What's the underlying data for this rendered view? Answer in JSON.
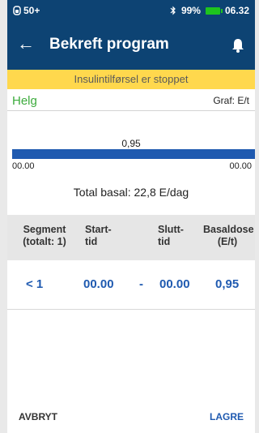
{
  "status_bar": {
    "pod_level": "50+",
    "battery_percent": "99%",
    "time": "06.32",
    "battery_color": "#1ec41e"
  },
  "header": {
    "title": "Bekreft program",
    "back_icon": "back-arrow-icon",
    "bell_icon": "bell-icon",
    "background_color": "#0d4373"
  },
  "banner": {
    "text": "Insulintilførsel er stoppet",
    "color": "#ffd84d"
  },
  "program": {
    "name": "Helg",
    "graph_unit": "Graf: E/t"
  },
  "graph": {
    "bar_label": "0,95",
    "start_tick": "00.00",
    "end_tick": "00.00",
    "bar_color": "#1f5ab0"
  },
  "total_basal": "Total basal: 22,8 E/dag",
  "table": {
    "headers": {
      "segment_line1": "Segment",
      "segment_line2": "(totalt: 1)",
      "start_line1": "Start-",
      "start_line2": "tid",
      "end_line1": "Slutt-",
      "end_line2": "tid",
      "dose_line1": "Basaldose",
      "dose_line2": "(E/t)"
    },
    "rows": [
      {
        "segment": "< 1",
        "start": "00.00",
        "dash": "-",
        "end": "00.00",
        "dose": "0,95"
      }
    ]
  },
  "footer": {
    "cancel_label": "AVBRYT",
    "save_label": "LAGRE"
  }
}
